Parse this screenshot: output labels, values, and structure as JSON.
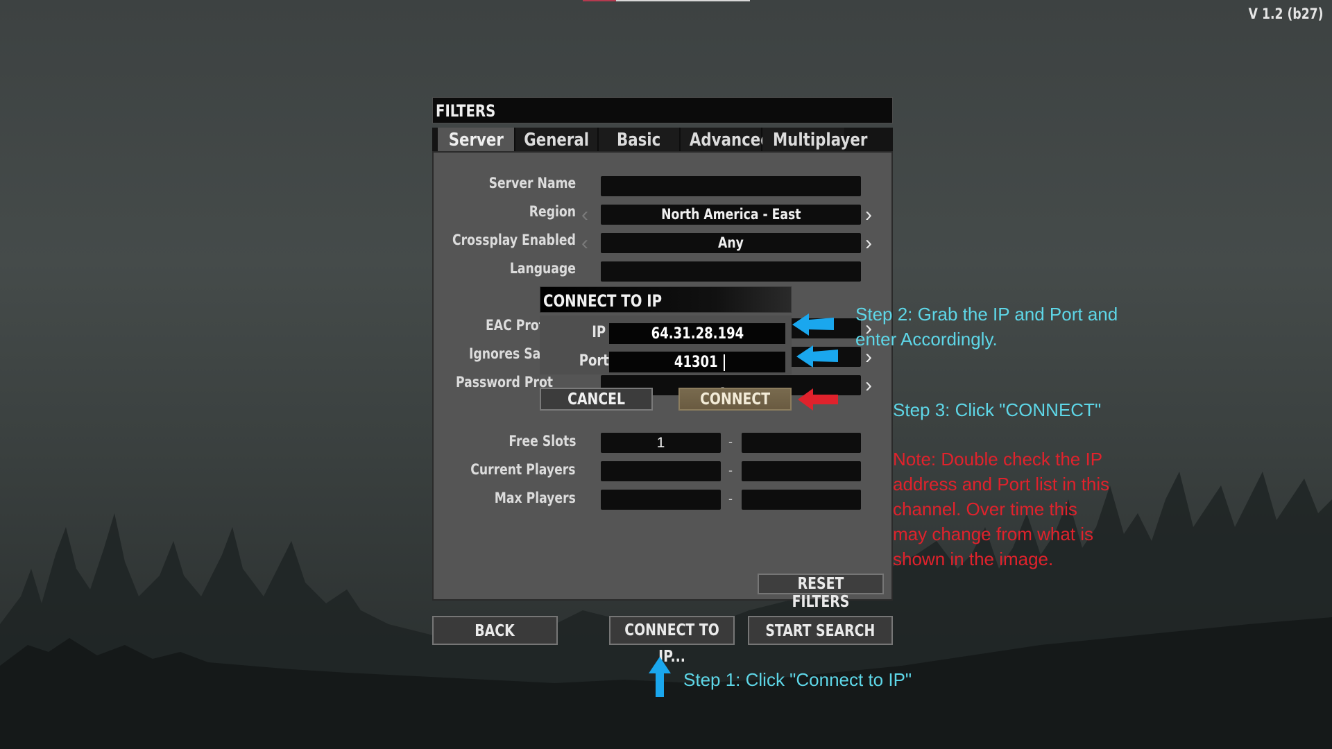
{
  "version": "V 1.2 (b27)",
  "filters_panel": {
    "title": "FILTERS",
    "tabs": [
      {
        "label": "Server",
        "active": true
      },
      {
        "label": "General",
        "active": false
      },
      {
        "label": "Basic",
        "active": false
      },
      {
        "label": "Advanced",
        "active": false
      },
      {
        "label": "Multiplayer",
        "active": false
      }
    ],
    "fields": {
      "server_name": {
        "label": "Server Name",
        "value": ""
      },
      "region": {
        "label": "Region",
        "value": "North America - East"
      },
      "crossplay": {
        "label": "Crossplay Enabled",
        "value": "Any"
      },
      "language": {
        "label": "Language",
        "value": ""
      },
      "eac": {
        "label": "EAC Prot"
      },
      "sanctions": {
        "label": "Ignores Sanc"
      },
      "password": {
        "label": "Password Prot",
        "value": "Any"
      },
      "free_slots": {
        "label": "Free Slots",
        "min": "1",
        "max": ""
      },
      "current_players": {
        "label": "Current Players",
        "min": "",
        "max": ""
      },
      "max_players": {
        "label": "Max Players",
        "min": "",
        "max": ""
      }
    },
    "range_separator": "-",
    "reset_label": "RESET FILTERS"
  },
  "bottom_buttons": {
    "back": "BACK",
    "connect_ip": "CONNECT TO IP...",
    "start_search": "START SEARCH"
  },
  "connect_dialog": {
    "title": "CONNECT TO IP",
    "ip_label": "IP",
    "ip_value": "64.31.28.194",
    "port_label": "Port",
    "port_value": "41301",
    "cancel_label": "CANCEL",
    "connect_label": "CONNECT"
  },
  "annotations": {
    "step1": "Step 1: Click \"Connect to IP\"",
    "step2_line1": "Step 2: Grab the IP and Port and",
    "step2_line2": "enter Accordingly.",
    "step3": "Step 3: Click \"CONNECT\"",
    "note_lines": [
      "Note: Double check the IP",
      "address and Port list in this",
      "channel. Over time this",
      "may change from what is",
      "shown in the image."
    ]
  },
  "colors": {
    "annotation_cyan": "#5ed7e8",
    "annotation_red": "#e0222c",
    "arrow_blue": "#1aa7ee",
    "arrow_red": "#e0222c",
    "connect_button": "#786a4e"
  }
}
